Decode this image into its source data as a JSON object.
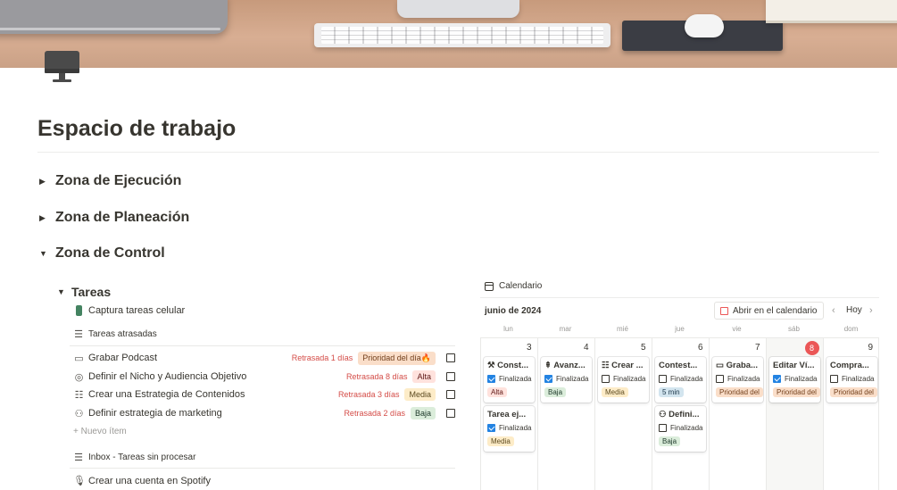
{
  "page": {
    "icon": "desktop-monitor-icon",
    "title": "Espacio de trabajo"
  },
  "zones": [
    {
      "label": "Zona de Ejecución",
      "expanded": false
    },
    {
      "label": "Zona de Planeación",
      "expanded": false
    },
    {
      "label": "Zona de Control",
      "expanded": true
    }
  ],
  "tareas": {
    "heading": "Tareas",
    "capture_link": "Captura tareas celular",
    "overdue_view": "Tareas atrasadas",
    "tasks": [
      {
        "icon": "tape-icon",
        "name": "Grabar Podcast",
        "late": "Retrasada 1 días",
        "priority": "Prioridad del día🔥",
        "priority_color": "orange"
      },
      {
        "icon": "target-icon",
        "name": "Definir el Nicho y Audiencia Objetivo",
        "late": "Retrasada 8 días",
        "priority": "Alta",
        "priority_color": "red"
      },
      {
        "icon": "checklist-icon",
        "name": "Crear una Estrategia de Contenidos",
        "late": "Retrasada 3 días",
        "priority": "Media",
        "priority_color": "yellow"
      },
      {
        "icon": "hierarchy-icon",
        "name": "Definir estrategia de marketing",
        "late": "Retrasada 2 días",
        "priority": "Baja",
        "priority_color": "green"
      }
    ],
    "new_item": "Nuevo ítem",
    "inbox_view": "Inbox - Tareas sin procesar",
    "inbox_first": "Crear una cuenta en Spotify"
  },
  "calendar": {
    "title": "Calendario",
    "month": "junio de 2024",
    "open_button": "Abrir en el calendario",
    "today_button": "Hoy",
    "weekdays": [
      "lun",
      "mar",
      "mié",
      "jue",
      "vie",
      "sáb",
      "dom"
    ],
    "days": [
      {
        "num": "3",
        "today": false,
        "cards": [
          {
            "title": "Const...",
            "icon": "hammer-icon",
            "done": true,
            "status": "Finalizada",
            "tag": "Alta",
            "tag_color": "red"
          },
          {
            "title": "Tarea ej...",
            "icon": "",
            "done": true,
            "status": "Finalizada",
            "tag": "Media",
            "tag_color": "yellow"
          }
        ]
      },
      {
        "num": "4",
        "today": false,
        "cards": [
          {
            "title": "Avanz...",
            "icon": "steps-icon",
            "done": true,
            "status": "Finalizada",
            "tag": "Baja",
            "tag_color": "green"
          }
        ]
      },
      {
        "num": "5",
        "today": false,
        "cards": [
          {
            "title": "Crear ...",
            "icon": "checklist-icon",
            "done": false,
            "status": "Finalizada",
            "tag": "Media",
            "tag_color": "yellow"
          }
        ]
      },
      {
        "num": "6",
        "today": false,
        "cards": [
          {
            "title": "Contest...",
            "icon": "",
            "done": false,
            "status": "Finalizada",
            "tag": "5 min",
            "tag_color": "blue"
          },
          {
            "title": "Defini...",
            "icon": "hierarchy-icon",
            "done": false,
            "status": "Finalizada",
            "tag": "Baja",
            "tag_color": "green"
          }
        ]
      },
      {
        "num": "7",
        "today": false,
        "cards": [
          {
            "title": "Graba...",
            "icon": "tape-icon",
            "done": false,
            "status": "Finalizada",
            "tag": "Prioridad del",
            "tag_color": "orange"
          }
        ]
      },
      {
        "num": "8",
        "today": true,
        "cards": [
          {
            "title": "Editar Ví...",
            "icon": "",
            "done": true,
            "status": "Finalizada",
            "tag": "Prioridad del",
            "tag_color": "orange"
          }
        ]
      },
      {
        "num": "9",
        "today": false,
        "cards": [
          {
            "title": "Compra...",
            "icon": "",
            "done": false,
            "status": "Finalizada",
            "tag": "Prioridad del",
            "tag_color": "orange"
          }
        ]
      }
    ]
  },
  "colors": {
    "accent_red": "#eb5757",
    "checkbox_blue": "#2383e2",
    "late_red": "#d44c47",
    "text": "#37352f"
  }
}
